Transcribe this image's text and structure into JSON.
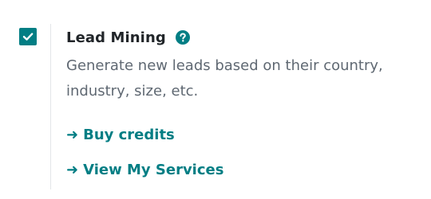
{
  "setting": {
    "checked": true,
    "title": "Lead Mining",
    "help_icon": "question-circle-icon",
    "description": "Generate new leads based on their country, industry, size, etc.",
    "links": [
      {
        "arrow": "➜",
        "label": "Buy credits"
      },
      {
        "arrow": "➜",
        "label": "View My Services"
      }
    ]
  },
  "colors": {
    "accent": "#017e84",
    "title": "#212529",
    "description": "#5f6872",
    "divider": "#e3e6e8"
  }
}
